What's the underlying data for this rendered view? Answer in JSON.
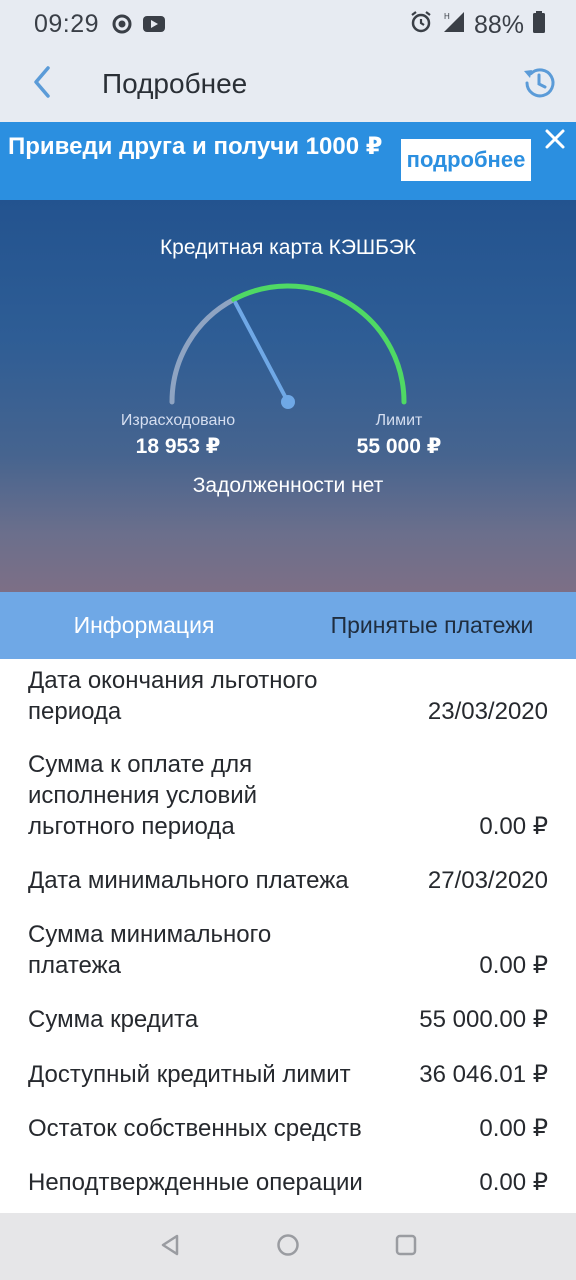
{
  "status": {
    "time": "09:29",
    "battery": "88%",
    "icons": [
      "record-icon",
      "youtube-icon",
      "alarm-icon",
      "signal-icon",
      "battery-icon"
    ]
  },
  "header": {
    "title": "Подробнее",
    "icons": [
      "back-arrow-icon",
      "history-icon"
    ],
    "accent": "#5b9bd8"
  },
  "promo": {
    "text": "Приведи друга и получи 1000 ₽",
    "button": "подробнее",
    "background": "#2b8fe0"
  },
  "card": {
    "name": "Кредитная карта КЭШБЭК",
    "spent_label": "Израсходовано",
    "spent_value": "18 953 ₽",
    "limit_label": "Лимит",
    "limit_value": "55 000 ₽",
    "debt_status": "Задолженности нет",
    "spent_fraction": 0.345,
    "arc_colors": {
      "spent": "#8fa4c2",
      "available": "#4fd964",
      "needle": "#6fa8e6"
    }
  },
  "tabs": [
    {
      "label": "Информация",
      "active": true
    },
    {
      "label": "Принятые платежи",
      "active": false
    }
  ],
  "info": [
    {
      "label": "Дата окончания льготного периода",
      "value": "23/03/2020"
    },
    {
      "label": "Сумма к оплате для исполнения условий льготного периода",
      "value": "0.00 ₽"
    },
    {
      "label": "Дата минимального платежа",
      "value": "27/03/2020"
    },
    {
      "label": "Сумма минимального платежа",
      "value": "0.00 ₽"
    },
    {
      "label": "Сумма кредита",
      "value": "55 000.00 ₽"
    },
    {
      "label": "Доступный кредитный лимит",
      "value": "36 046.01 ₽"
    },
    {
      "label": "Остаток собственных средств",
      "value": "0.00 ₽"
    },
    {
      "label": "Неподтвержденные операции",
      "value": "0.00 ₽"
    }
  ],
  "navbar": {
    "icons": [
      "back-triangle-icon",
      "home-circle-icon",
      "recents-square-icon"
    ]
  }
}
